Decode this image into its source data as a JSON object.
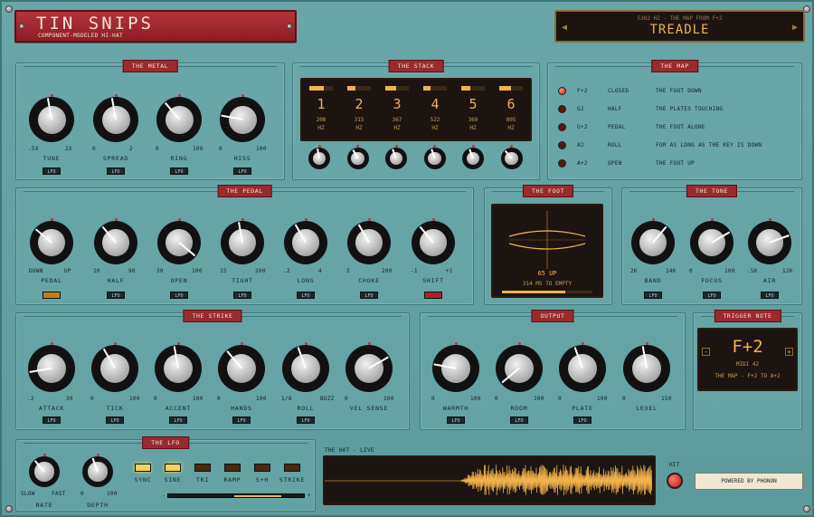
{
  "header": {
    "title": "TIN SNIPS",
    "subtitle": "COMPONENT-MODELED HI-HAT"
  },
  "preset": {
    "sub": "5302 HZ - THE MAP FROM F+2",
    "name": "TREADLE",
    "prev": "◀",
    "next": "▶"
  },
  "metal": {
    "title": "THE METAL",
    "knobs": [
      {
        "name": "TUNE",
        "min": ".5X",
        "max": "2X",
        "lfo": "LFO"
      },
      {
        "name": "SPREAD",
        "min": "0",
        "max": "2",
        "lfo": "LFO"
      },
      {
        "name": "RING",
        "min": "0",
        "max": "100",
        "lfo": "LFO"
      },
      {
        "name": "HISS",
        "min": "0",
        "max": "100",
        "lfo": "LFO"
      }
    ]
  },
  "stack": {
    "title": "THE STACK",
    "voices": [
      {
        "num": "1",
        "freq": "208",
        "unit": "HZ"
      },
      {
        "num": "2",
        "freq": "315",
        "unit": "HZ"
      },
      {
        "num": "3",
        "freq": "367",
        "unit": "HZ"
      },
      {
        "num": "4",
        "freq": "522",
        "unit": "HZ"
      },
      {
        "num": "5",
        "freq": "369",
        "unit": "HZ"
      },
      {
        "num": "6",
        "freq": "805",
        "unit": "HZ"
      }
    ]
  },
  "map": {
    "title": "THE MAP",
    "rows": [
      {
        "note": "F+2",
        "name": "CLOSED",
        "desc": "THE FOOT DOWN",
        "active": true
      },
      {
        "note": "G2",
        "name": "HALF",
        "desc": "THE PLATES TOUCHING",
        "active": false
      },
      {
        "note": "G+2",
        "name": "PEDAL",
        "desc": "THE FOOT ALONE",
        "active": false
      },
      {
        "note": "A2",
        "name": "ROLL",
        "desc": "FOR AS LONG AS THE KEY IS DOWN",
        "active": false
      },
      {
        "note": "A+2",
        "name": "OPEN",
        "desc": "THE FOOT UP",
        "active": false
      }
    ]
  },
  "pedal": {
    "title": "THE PEDAL",
    "knobs": [
      {
        "name": "PEDAL",
        "min": "DOWN",
        "max": "UP",
        "lfo": ""
      },
      {
        "name": "HALF",
        "min": "10",
        "max": "90",
        "lfo": "LFO"
      },
      {
        "name": "OPEN",
        "min": "30",
        "max": "100",
        "lfo": "LFO"
      },
      {
        "name": "TIGHT",
        "min": "15",
        "max": "200",
        "lfo": "LFO"
      },
      {
        "name": "LONG",
        "min": ".2",
        "max": "4",
        "lfo": "LFO"
      },
      {
        "name": "CHOKE",
        "min": "2",
        "max": "200",
        "lfo": "LFO"
      },
      {
        "name": "SHIFT",
        "min": "-1",
        "max": "+1",
        "lfo": ""
      }
    ]
  },
  "foot": {
    "title": "THE FOOT",
    "value": "65 UP",
    "status": "314 MS TO EMPTY",
    "level": 0.7
  },
  "tone": {
    "title": "THE TONE",
    "knobs": [
      {
        "name": "BAND",
        "min": "2K",
        "max": "14K",
        "lfo": "LFO"
      },
      {
        "name": "FOCUS",
        "min": "0",
        "max": "100",
        "lfo": "LFO"
      },
      {
        "name": "AIR",
        "min": ".5K",
        "max": "12K",
        "lfo": "LFO"
      }
    ]
  },
  "strike": {
    "title": "THE STRIKE",
    "knobs": [
      {
        "name": "ATTACK",
        "min": ".2",
        "max": "30",
        "lfo": "LFO"
      },
      {
        "name": "TICK",
        "min": "0",
        "max": "100",
        "lfo": "LFO"
      },
      {
        "name": "ACCENT",
        "min": "0",
        "max": "100",
        "lfo": "LFO"
      },
      {
        "name": "HANDS",
        "min": "0",
        "max": "100",
        "lfo": "LFO"
      },
      {
        "name": "ROLL",
        "min": "1/8",
        "max": "BUZZ",
        "lfo": "LFO"
      },
      {
        "name": "VEL SENSE",
        "min": "0",
        "max": "100",
        "lfo": ""
      }
    ]
  },
  "output": {
    "title": "OUTPUT",
    "knobs": [
      {
        "name": "WARMTH",
        "min": "0",
        "max": "100",
        "lfo": "LFO"
      },
      {
        "name": "ROOM",
        "min": "0",
        "max": "100",
        "lfo": "LFO"
      },
      {
        "name": "PLATE",
        "min": "0",
        "max": "100",
        "lfo": "LFO"
      },
      {
        "name": "LEVEL",
        "min": "0",
        "max": "150",
        "lfo": ""
      }
    ]
  },
  "trigger": {
    "title": "TRIGGER NOTE",
    "note": "F+2",
    "midi": "MIDI 42",
    "desc": "THE MAP - F+2 TO A+2",
    "minus": "-",
    "plus": "+"
  },
  "lfo": {
    "title": "THE LFO",
    "rate": "RATE",
    "depth": "DEPTH",
    "rate_min": "SLOW",
    "rate_max": "FAST",
    "depth_min": "0",
    "depth_max": "100",
    "buttons": [
      {
        "label": "SYNC",
        "on": true
      },
      {
        "label": "SINE",
        "on": true
      },
      {
        "label": "TRI",
        "on": false
      },
      {
        "label": "RAMP",
        "on": false
      },
      {
        "label": "S+H",
        "on": false
      },
      {
        "label": "STRIKE",
        "on": false
      }
    ],
    "minus": "-",
    "plus": "+"
  },
  "scope": {
    "title": "THE HAT - LIVE"
  },
  "hit": {
    "label": "HIT"
  },
  "footer": {
    "powered": "POWERED BY PHONON"
  }
}
